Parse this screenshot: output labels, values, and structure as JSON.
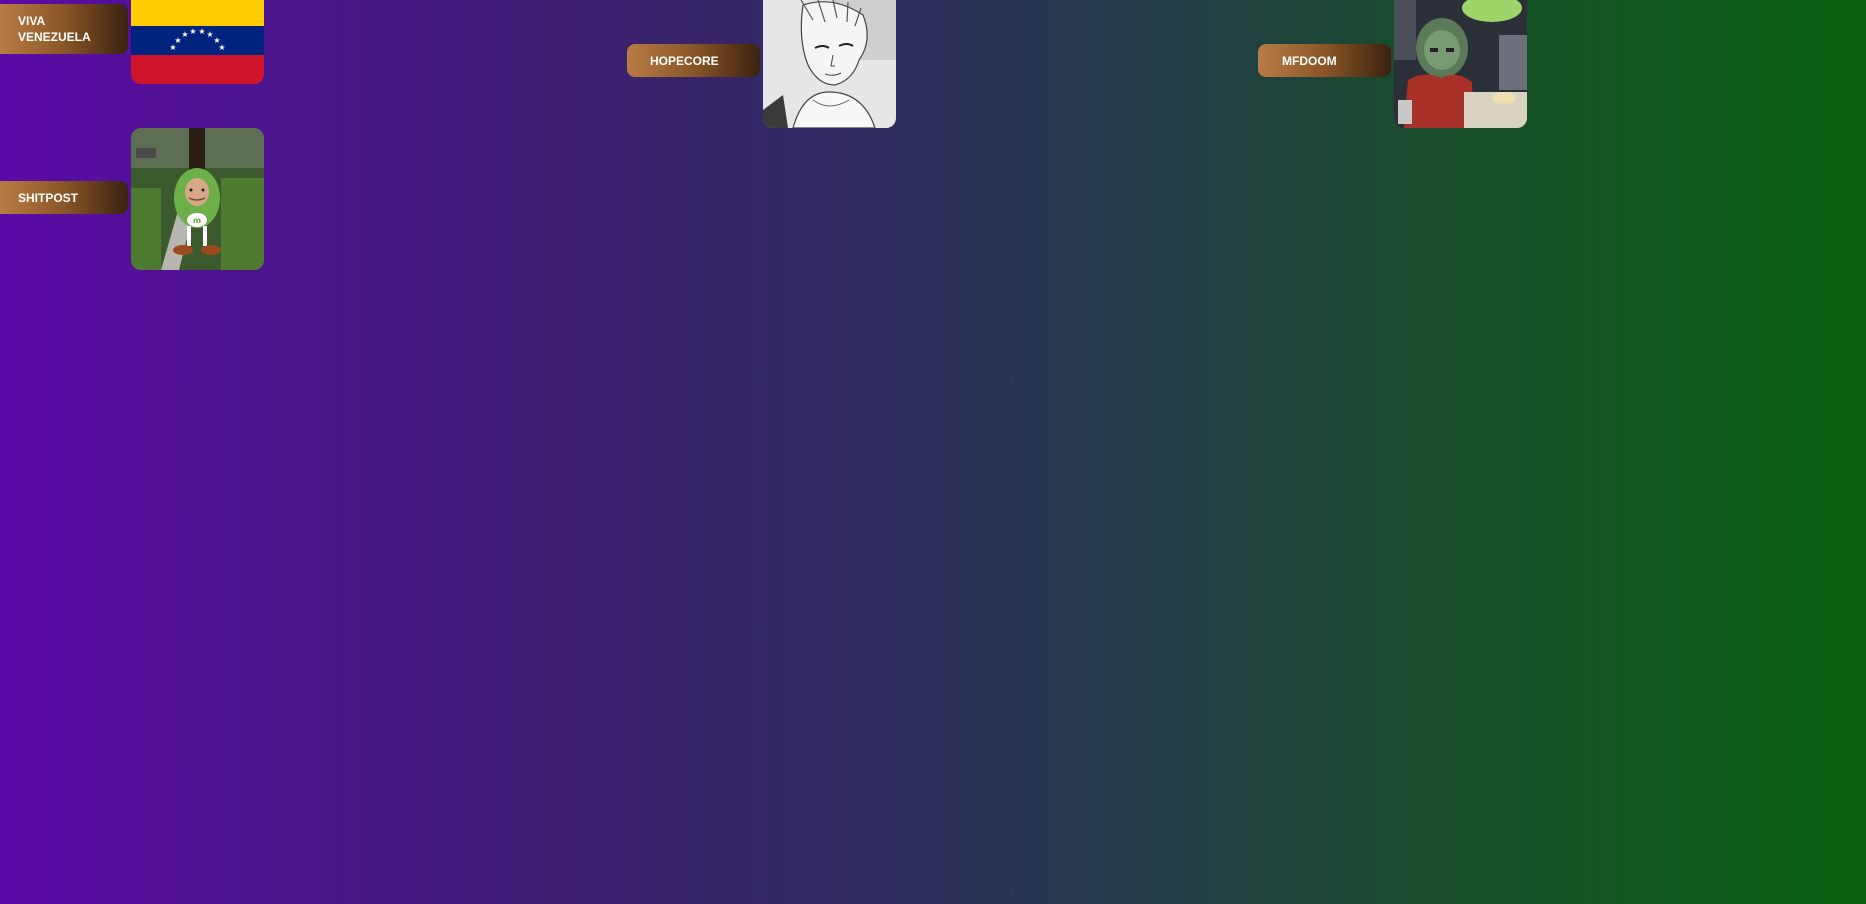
{
  "tiles": [
    {
      "label": "VIVA VENEZUELA",
      "image": "venezuela-flag"
    },
    {
      "label": "HOPECORE",
      "image": "manga-portrait"
    },
    {
      "label": "MFDOOM",
      "image": "mfdoom-album-art"
    },
    {
      "label": "SHITPOST",
      "image": "green-mm-character"
    }
  ],
  "colors": {
    "bg_left": "#5a0ba6",
    "bg_right": "#0a6010",
    "label_light": "#b87c45",
    "label_dark": "#3a2210"
  }
}
